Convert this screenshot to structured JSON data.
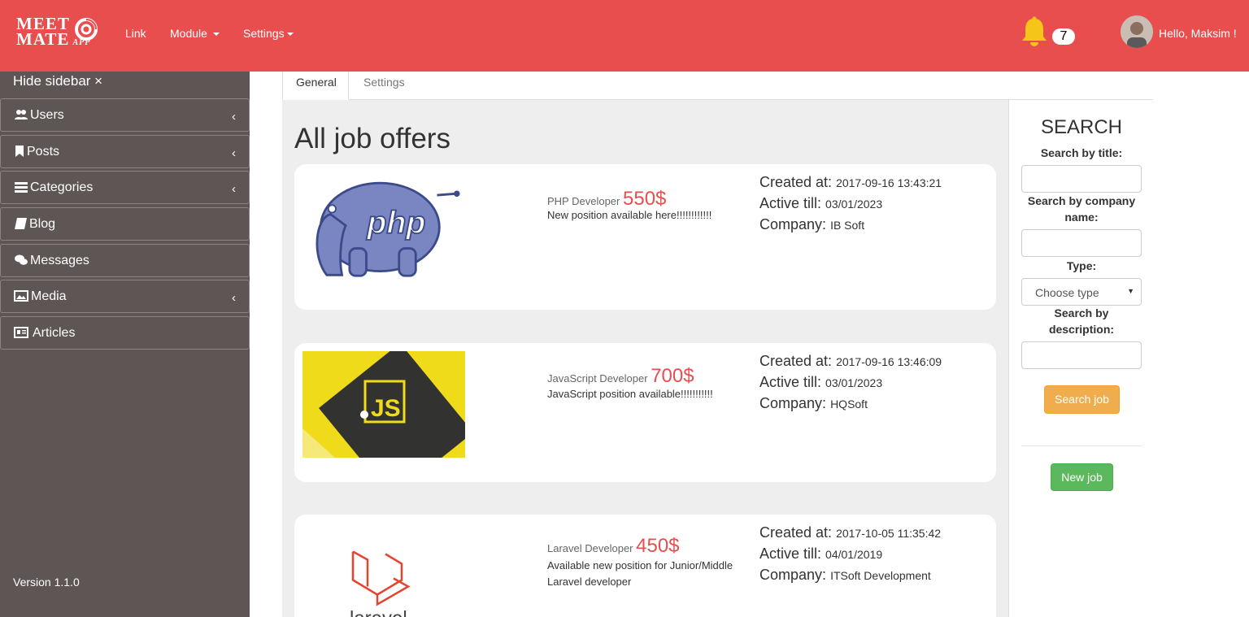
{
  "navbar": {
    "logo_line1": "MEET",
    "logo_line2": "MATE",
    "logo_app": "APP",
    "link_label": "Link",
    "module_label": "Module",
    "settings_label": "Settings",
    "notification_count": "7",
    "greeting": "Hello, Maksim !",
    "accent_color": "#e94e4e"
  },
  "sidebar": {
    "hide_label": "Hide sidebar ×",
    "items": [
      {
        "label": "Users",
        "icon": "users-icon",
        "expandable": true
      },
      {
        "label": "Posts",
        "icon": "bookmark-icon",
        "expandable": true
      },
      {
        "label": "Categories",
        "icon": "list-icon",
        "expandable": true
      },
      {
        "label": "Blog",
        "icon": "book-icon",
        "expandable": false
      },
      {
        "label": "Messages",
        "icon": "comments-icon",
        "expandable": false
      },
      {
        "label": "Media",
        "icon": "picture-icon",
        "expandable": true
      },
      {
        "label": "Articles",
        "icon": "newspaper-icon",
        "expandable": false
      }
    ],
    "chevron": "‹",
    "version": "Version 1.1.0"
  },
  "tabs": [
    {
      "label": "General",
      "active": true
    },
    {
      "label": "Settings",
      "active": false
    }
  ],
  "main": {
    "title": "All job offers",
    "jobs": [
      {
        "title": "PHP Developer",
        "price": "550$",
        "description": "New position available here!!!!!!!!!!!!",
        "created_label": "Created at:",
        "created": "2017-09-16 13:43:21",
        "active_label": "Active till:",
        "active": "03/01/2023",
        "company_label": "Company:",
        "company": "IB Soft",
        "logo": "php-elephant-logo"
      },
      {
        "title": "JavaScript Developer",
        "price": "700$",
        "description": "JavaScript position available!!!!!!!!!!!",
        "created_label": "Created at:",
        "created": "2017-09-16 13:46:09",
        "active_label": "Active till:",
        "active": "03/01/2023",
        "company_label": "Company:",
        "company": "HQSoft",
        "logo": "js-logo",
        "logo_text": "JS"
      },
      {
        "title": "Laravel Developer",
        "price": "450$",
        "description": "Available new position for Junior/Middle Laravel developer",
        "created_label": "Created at:",
        "created": "2017-10-05 11:35:42",
        "active_label": "Active till:",
        "active": "04/01/2019",
        "company_label": "Company:",
        "company": "ITSoft Development",
        "logo": "laravel-logo",
        "logo_text": "laravel"
      }
    ]
  },
  "search": {
    "heading": "SEARCH",
    "title_label": "Search by title:",
    "company_label": "Search by company name:",
    "type_label": "Type:",
    "type_selected": "Choose type",
    "description_label": "Search by description:",
    "search_button": "Search job",
    "new_button": "New job"
  }
}
